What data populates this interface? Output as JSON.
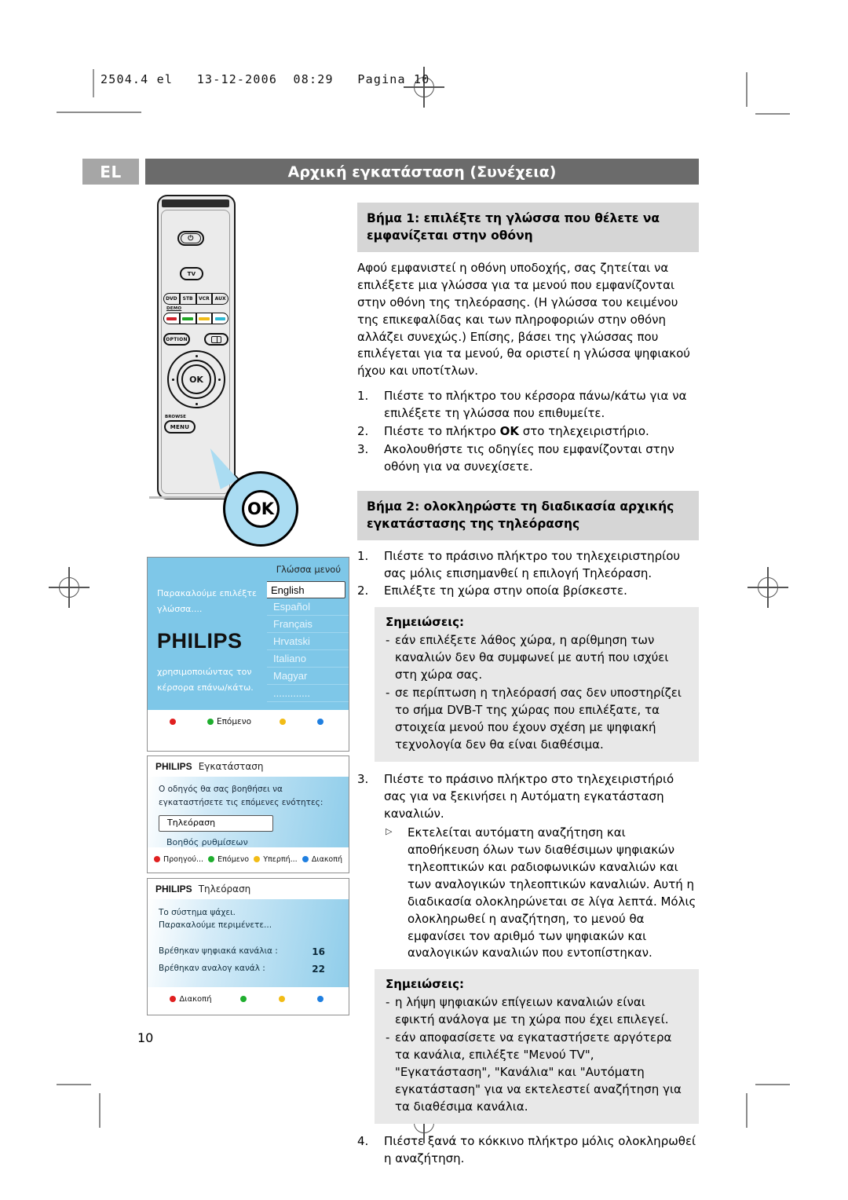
{
  "slug": "2504.4 el   13-12-2006  08:29   Pagina 10",
  "header": {
    "lang_code": "EL",
    "title": "Αρχική εγκατάσταση (Συνέχεια)"
  },
  "page_number": "10",
  "step1": {
    "heading": "Βήμα 1: επιλέξτε τη γλώσσα που θέλετε να εμφανίζεται στην οθόνη",
    "paragraph": "Αφού εμφανιστεί η οθόνη υποδοχής, σας ζητείται να επιλέξετε μια γλώσσα για τα μενού που εμφανίζονται στην οθόνη της τηλεόρασης. (Η γλώσσα του κειμένου της επικεφαλίδας και των πληροφοριών στην οθόνη αλλάζει συνεχώς.) Επίσης, βάσει της γλώσσας που επιλέγεται για τα μενού, θα οριστεί η γλώσσα ψηφιακού ήχου και υποτίτλων.",
    "items": [
      {
        "num": "1.",
        "text": "Πιέστε το πλήκτρο του κέρσορα πάνω/κάτω για να επιλέξετε τη γλώσσα που επιθυμείτε."
      },
      {
        "num": "2.",
        "text": "Πιέστε το πλήκτρο OK στο τηλεχειριστήριο.",
        "bold_token": "OK"
      },
      {
        "num": "3.",
        "text": "Ακολουθήστε τις οδηγίες που εμφανίζονται στην οθόνη για να συνεχίσετε."
      }
    ]
  },
  "step2": {
    "heading": "Βήμα 2: ολοκληρώστε τη διαδικασία αρχικής εγκατάστασης της τηλεόρασης",
    "items": [
      {
        "num": "1.",
        "text": "Πιέστε το πράσινο πλήκτρο του τηλεχειριστηρίου σας μόλις επισημανθεί η επιλογή Τηλεόραση."
      },
      {
        "num": "2.",
        "text": "Επιλέξτε τη χώρα στην οποία βρίσκεστε."
      }
    ],
    "note1": {
      "label": "Σημειώσεις:",
      "bullets": [
        "εάν επιλέξετε λάθος χώρα, η αρίθμηση των καναλιών δεν θα συμφωνεί με αυτή που ισχύει στη χώρα σας.",
        "σε περίπτωση η τηλεόρασή σας δεν υποστηρίζει το σήμα DVB-T της χώρας που επιλέξατε, τα στοιχεία μενού που έχουν σχέση με ψηφιακή τεχνολογία δεν θα είναι διαθέσιμα."
      ]
    },
    "item3": {
      "num": "3.",
      "text": "Πιέστε το πράσινο πλήκτρο στο τηλεχειριστήριό σας για να ξεκινήσει η Αυτόματη εγκατάσταση καναλιών.",
      "sub_bullet": "Εκτελείται αυτόματη αναζήτηση και αποθήκευση όλων των διαθέσιμων ψηφιακών τηλεοπτικών και ραδιοφωνικών καναλιών και των αναλογικών τηλεοπτικών καναλιών. Αυτή η διαδικασία ολοκληρώνεται σε λίγα λεπτά. Μόλις ολοκληρωθεί η αναζήτηση, το μενού θα εμφανίσει τον αριθμό των ψηφιακών και αναλογικών καναλιών που εντοπίστηκαν."
    },
    "note2": {
      "label": "Σημειώσεις:",
      "bullets": [
        "η λήψη ψηφιακών επίγειων καναλιών είναι εφικτή ανάλογα με τη χώρα που έχει επιλεγεί.",
        "εάν αποφασίσετε να εγκαταστήσετε αργότερα τα κανάλια, επιλέξτε \"Μενού TV\", \"Εγκατάσταση\", \"Κανάλια\" και \"Αυτόματη εγκατάσταση\" για να εκτελεστεί αναζήτηση για τα διαθέσιμα κανάλια."
      ]
    },
    "item4": {
      "num": "4.",
      "text": "Πιέστε ξανά το κόκκινο πλήκτρο μόλις ολοκληρωθεί η αναζήτηση."
    }
  },
  "remote": {
    "power_label": "⏻",
    "tv_label": "TV",
    "source_buttons": [
      "DVD",
      "STB",
      "VCR",
      "AUX"
    ],
    "demo_label": "DEMO",
    "color_buttons": [
      {
        "name": "red-color-button",
        "color": "#d0212a"
      },
      {
        "name": "green-color-button",
        "color": "#1fa524"
      },
      {
        "name": "yellow-color-button",
        "color": "#f0bb17"
      },
      {
        "name": "cyan-color-button",
        "color": "#2cb8d4"
      }
    ],
    "option_label": "OPTION",
    "book_label": "book-icon",
    "ok_label": "OK",
    "browse_label": "BROWSE",
    "menu_label": "MENU",
    "callout_label": "OK"
  },
  "tv1": {
    "header_title": "Γλώσσα μενού",
    "left_top_line1": "Παρακαλούμε επιλέξτε",
    "left_top_line2": "γλώσσα....",
    "brand": "PHILIPS",
    "left_bottom_line1": "χρησιμοποιώντας τον",
    "left_bottom_line2": "κέρσορα επάνω/κάτω.",
    "languages": [
      "English",
      "Español",
      "Français",
      "Hrvatski",
      "Italiano",
      "Magyar",
      "............."
    ],
    "selected_language": "English",
    "footer": [
      {
        "color": "red",
        "label": ""
      },
      {
        "color": "green",
        "label": "Επόμενο"
      },
      {
        "color": "yellow",
        "label": ""
      },
      {
        "color": "blue",
        "label": ""
      }
    ]
  },
  "tv2": {
    "brand": "PHILIPS",
    "header_title": "Εγκατάσταση",
    "line1": "Ο οδηγός θα σας βοηθήσει να",
    "line2": "εγκαταστήσετε τις επόμενες  ενότητες:",
    "selected_item": "Τηλεόραση",
    "second_item": "Βοηθός ρυθμίσεων",
    "footer": [
      {
        "color": "red",
        "label": "Προηγού..."
      },
      {
        "color": "green",
        "label": "Επόμενο"
      },
      {
        "color": "yellow",
        "label": "Υπερπή..."
      },
      {
        "color": "blue",
        "label": "Διακοπή"
      }
    ]
  },
  "tv3": {
    "brand": "PHILIPS",
    "header_title": "Τηλεόραση",
    "line1": "Το σύστημα ψάχει.",
    "line2": "Παρακαλούμε περιμένετε...",
    "digital_label": "Βρέθηκαν ψηφιακά κανάλια :",
    "digital_value": "16",
    "analog_label": "Βρέθηκαν αναλογ κανάλ :",
    "analog_value": "22",
    "footer": [
      {
        "color": "red",
        "label": "Διακοπή"
      },
      {
        "color": "green",
        "label": ""
      },
      {
        "color": "yellow",
        "label": ""
      },
      {
        "color": "blue",
        "label": ""
      }
    ]
  },
  "colors": {
    "title_bar": "#6b6b6b",
    "lang_tab": "#a6a6a6",
    "step_heading_bg": "#d6d6d6",
    "note_bg": "#e8e8e8",
    "tv_blue": "#7ec7e8",
    "callout_blue": "#aadcf2"
  }
}
